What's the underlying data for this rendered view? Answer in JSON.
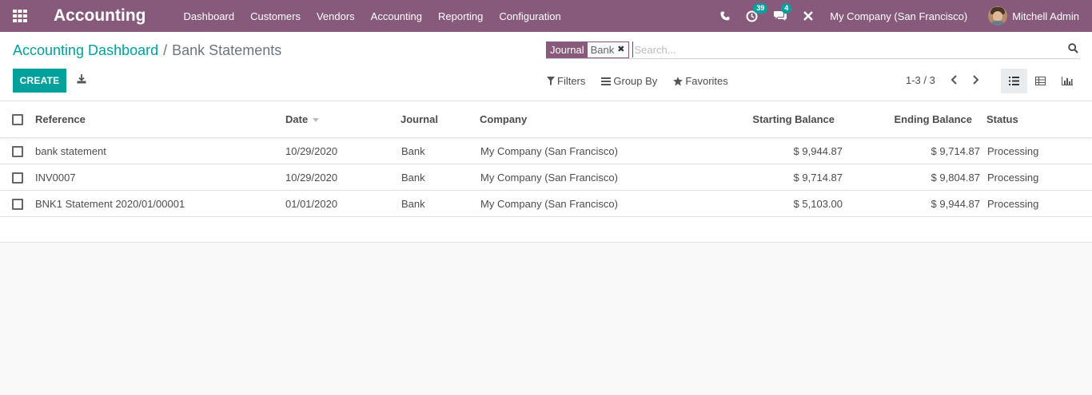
{
  "navbar": {
    "app_name": "Accounting",
    "menu": [
      "Dashboard",
      "Customers",
      "Vendors",
      "Accounting",
      "Reporting",
      "Configuration"
    ],
    "activity_count": "39",
    "messages_count": "4",
    "company": "My Company (San Francisco)",
    "user": "Mitchell Admin",
    "icons": [
      "apps-grid-icon",
      "phone-icon",
      "activity-clock-icon",
      "chat-icon",
      "debug-wrench-icon",
      "avatar"
    ]
  },
  "breadcrumb": {
    "parent": "Accounting Dashboard",
    "separator": "/",
    "current": "Bank Statements"
  },
  "search": {
    "facet_name": "Journal",
    "facet_value": "Bank",
    "placeholder": "Search..."
  },
  "actions": {
    "create_label": "CREATE"
  },
  "filters": {
    "filters_label": "Filters",
    "groupby_label": "Group By",
    "favorites_label": "Favorites"
  },
  "pager": {
    "value": "1-3 / 3"
  },
  "table": {
    "columns": {
      "reference": "Reference",
      "date": "Date",
      "journal": "Journal",
      "company": "Company",
      "starting_balance": "Starting Balance",
      "ending_balance": "Ending Balance",
      "status": "Status"
    },
    "rows": [
      {
        "reference": "bank statement",
        "date": "10/29/2020",
        "journal": "Bank",
        "company": "My Company (San Francisco)",
        "starting_balance": "$ 9,944.87",
        "ending_balance": "$ 9,714.87",
        "status": "Processing"
      },
      {
        "reference": "INV0007",
        "date": "10/29/2020",
        "journal": "Bank",
        "company": "My Company (San Francisco)",
        "starting_balance": "$ 9,714.87",
        "ending_balance": "$ 9,804.87",
        "status": "Processing"
      },
      {
        "reference": "BNK1 Statement 2020/01/00001",
        "date": "01/01/2020",
        "journal": "Bank",
        "company": "My Company (San Francisco)",
        "starting_balance": "$ 5,103.00",
        "ending_balance": "$ 9,944.87",
        "status": "Processing"
      }
    ]
  },
  "colors": {
    "navbar": "#875a7b",
    "primary": "#00a09d",
    "background": "#f9f9f9"
  }
}
